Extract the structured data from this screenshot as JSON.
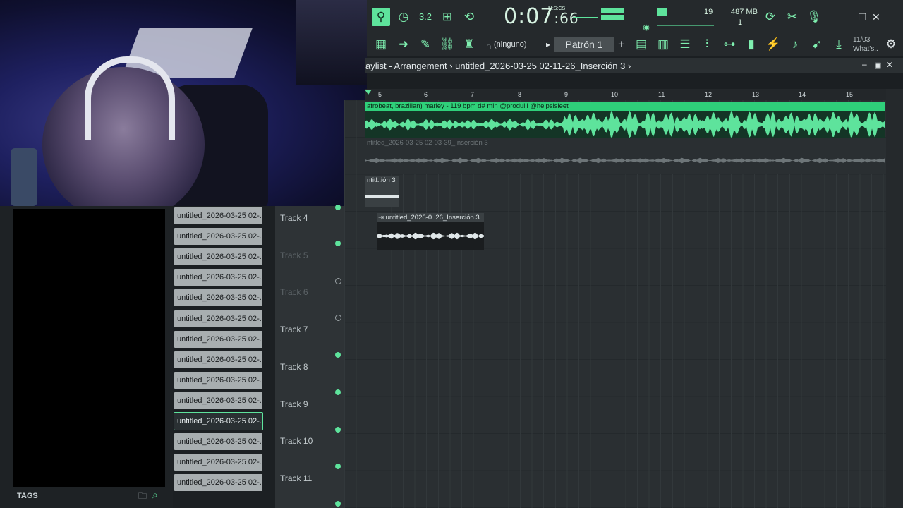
{
  "webcam": {
    "label": "webcam"
  },
  "toolbar": {
    "time_main": "0:07",
    "time_sub": ":66",
    "time_unit": "M:S:CS",
    "cpu": "19",
    "memory": "487 MB",
    "polyphony": "1",
    "tempo_btn": "3.2",
    "ninguno": "(ninguno)",
    "pattern": "Patrón 1",
    "pattern_add": "+",
    "news_date": "11/03",
    "news_text": "What's..",
    "play_arrow": "▸"
  },
  "playlist": {
    "title": "aylist - Arrangement",
    "arrow": "›",
    "project": "untitled_2026-03-25 02-11-26_Inserción 3",
    "ruler": [
      "5",
      "6",
      "7",
      "8",
      "9",
      "10",
      "11",
      "12",
      "13",
      "14",
      "15"
    ]
  },
  "clips": {
    "clip1": "afrobeat, brazilian) marley - 119 bpm d# min @produlii @helpsisleet",
    "clip2": "ntitled_2026-03-25 02-03-39_Inserción 3",
    "clip3": "ntitl..ión 3",
    "clip4": "untitled_2026-0..26_Inserción 3"
  },
  "tracks": [
    {
      "name": "Track 4",
      "enabled": true
    },
    {
      "name": "Track 5",
      "enabled": false
    },
    {
      "name": "Track 6",
      "enabled": false
    },
    {
      "name": "Track 7",
      "enabled": true
    },
    {
      "name": "Track 8",
      "enabled": true
    },
    {
      "name": "Track 9",
      "enabled": true
    },
    {
      "name": "Track 10",
      "enabled": true
    },
    {
      "name": "Track 11",
      "enabled": true
    }
  ],
  "browser": {
    "tags_label": "TAGS",
    "files": [
      "untitled_2026-03-25 02-...",
      "untitled_2026-03-25 02-...",
      "untitled_2026-03-25 02-...",
      "untitled_2026-03-25 02-...",
      "untitled_2026-03-25 02-...",
      "untitled_2026-03-25 02-...",
      "untitled_2026-03-25 02-...",
      "untitled_2026-03-25 02-...",
      "untitled_2026-03-25 02-...",
      "untitled_2026-03-25 02-...",
      "untitled_2026-03-25 02-...",
      "untitled_2026-03-25 02-...",
      "untitled_2026-03-25 02-...",
      "untitled_2026-03-25 02-..."
    ],
    "selected_index": 10
  },
  "colors": {
    "accent": "#5ee39c",
    "bg": "#25292c",
    "clip_green": "#2fd07a"
  }
}
